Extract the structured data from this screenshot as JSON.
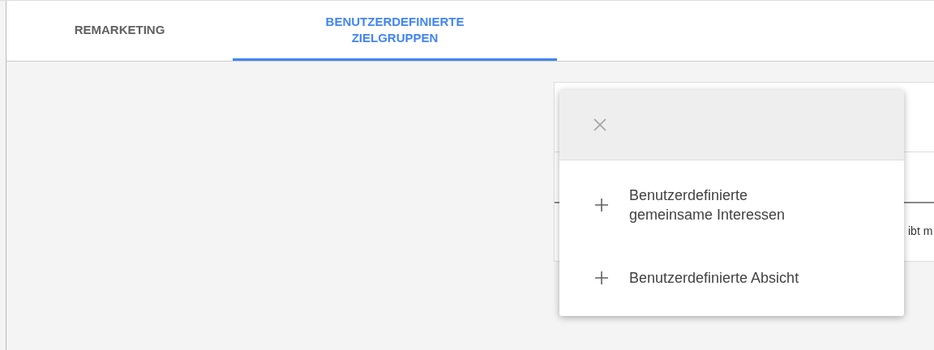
{
  "tabs": [
    {
      "label": "REMARKETING",
      "selected": false
    },
    {
      "label": "BENUTZERDEFINIERTE\nZIELGRUPPEN",
      "selected": true
    }
  ],
  "background_card": {
    "text": "ibt m"
  },
  "menu": {
    "items": [
      {
        "label": "Benutzerdefinierte\ngemeinsame Interessen"
      },
      {
        "label": "Benutzerdefinierte Absicht"
      }
    ]
  }
}
